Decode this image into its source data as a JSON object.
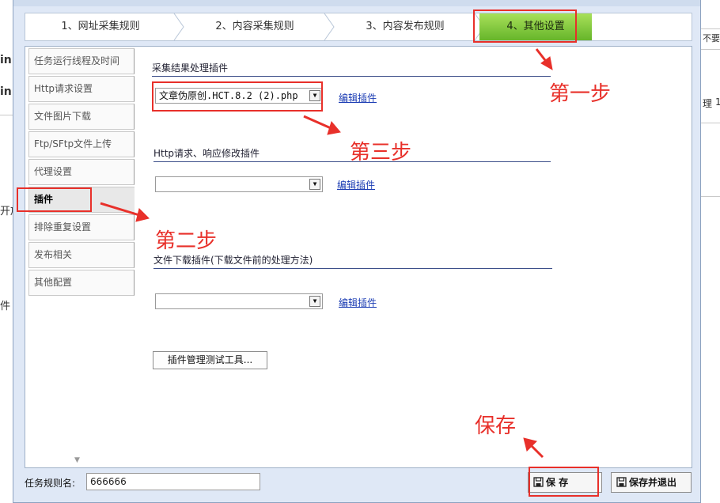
{
  "background": {
    "fragments": [
      "in",
      "in",
      "开放",
      "件",
      "不要",
      "理",
      "1"
    ]
  },
  "steps": [
    {
      "label": "1、网址采集规则"
    },
    {
      "label": "2、内容采集规则"
    },
    {
      "label": "3、内容发布规则"
    },
    {
      "label": "4、其他设置"
    }
  ],
  "sidebar": [
    {
      "label": "任务运行线程及时间"
    },
    {
      "label": "Http请求设置"
    },
    {
      "label": "文件图片下载"
    },
    {
      "label": "Ftp/SFtp文件上传"
    },
    {
      "label": "代理设置"
    },
    {
      "label": "插件"
    },
    {
      "label": "排除重复设置"
    },
    {
      "label": "发布相关"
    },
    {
      "label": "其他配置"
    }
  ],
  "sections": {
    "result_plugin": {
      "title": "采集结果处理插件",
      "value": "文章伪原创.HCT.8.2 (2).php",
      "link": "编辑插件"
    },
    "http_plugin": {
      "title": "Http请求、响应修改插件",
      "value": "",
      "link": "编辑插件"
    },
    "download_plugin": {
      "title": "文件下载插件(下载文件前的处理方法)",
      "value": "",
      "link": "编辑插件"
    }
  },
  "test_tool_button": "插件管理测试工具...",
  "footer": {
    "task_label": "任务规则名:",
    "task_value": "666666",
    "save_label": "保 存",
    "save_exit_label": "保存并退出"
  },
  "annotations": {
    "step1": "第一步",
    "step2": "第二步",
    "step3": "第三步",
    "save": "保存",
    "color": "#e8302a"
  }
}
